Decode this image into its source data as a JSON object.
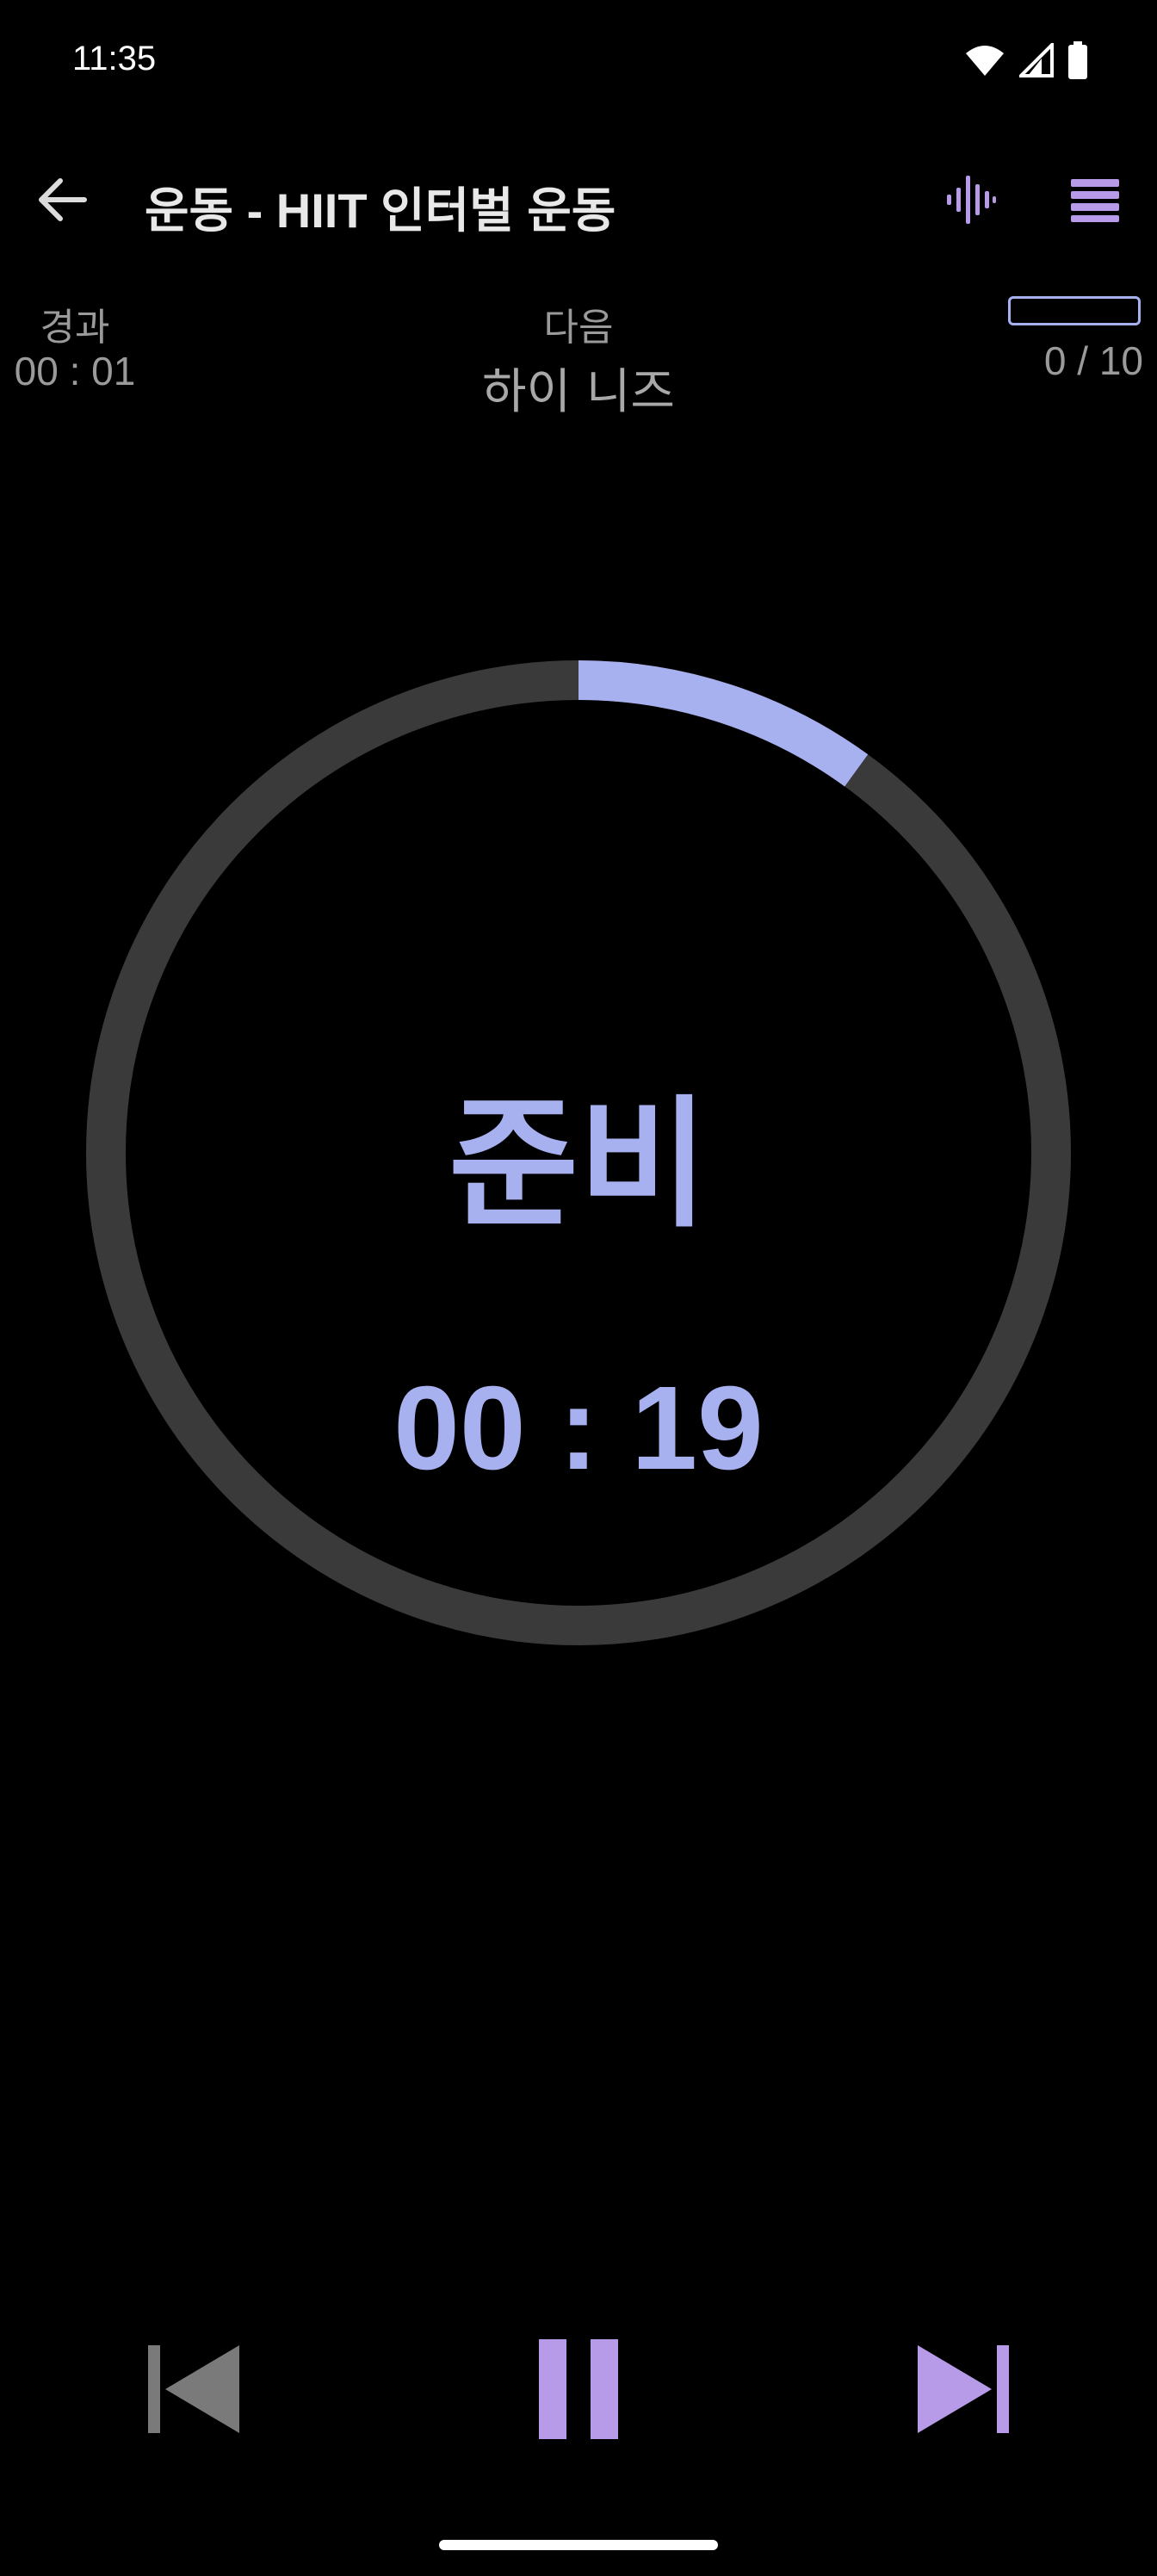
{
  "status_bar": {
    "time": "11:35",
    "icons": [
      "wifi-icon",
      "cell-signal-icon",
      "battery-icon"
    ]
  },
  "app_bar": {
    "title": "운동 - HIIT 인터벌 운동",
    "icons": [
      "back-arrow-icon",
      "waveform-icon",
      "menu-icon"
    ]
  },
  "info": {
    "elapsed_label": "경과",
    "elapsed_value": "00 : 01",
    "next_label": "다음",
    "next_value": "하이 니즈",
    "count": "0 / 10",
    "exercise_progress": 0
  },
  "timer": {
    "phase": "준비",
    "time": "00 : 19",
    "ring_progress": 0.1
  },
  "controls": {
    "icons": [
      "skip-previous-icon",
      "pause-icon",
      "skip-next-icon"
    ]
  },
  "colors": {
    "accent": "#a8b1f0",
    "button_purple": "#b79be8",
    "ring_track": "#3a3a3a",
    "muted_text": "#9a9a9a",
    "disabled": "#7a7a7a",
    "background": "#000000"
  }
}
